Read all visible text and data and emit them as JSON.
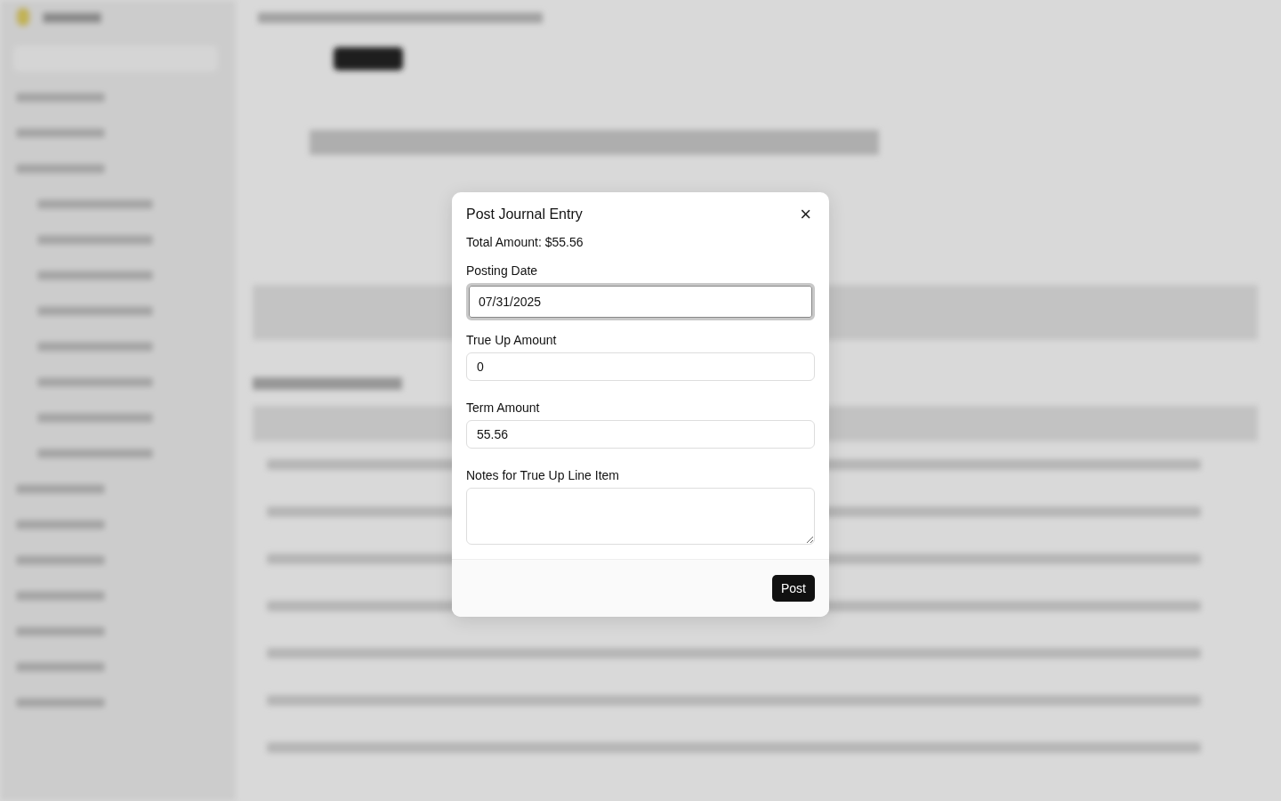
{
  "dialog": {
    "title": "Post Journal Entry",
    "close_icon": "×",
    "total": "Total Amount: $55.56",
    "fields": [
      {
        "label": "Posting Date",
        "value": "07/31/2025",
        "kind": "input",
        "focused": true
      },
      {
        "label": "True Up Amount",
        "value": "0",
        "kind": "input",
        "focused": false
      },
      {
        "label": "Term Amount",
        "value": "55.56",
        "kind": "input",
        "focused": false
      },
      {
        "label": "Notes for True Up Line Item",
        "kind": "textarea",
        "focused": false
      }
    ],
    "button": "Post"
  }
}
